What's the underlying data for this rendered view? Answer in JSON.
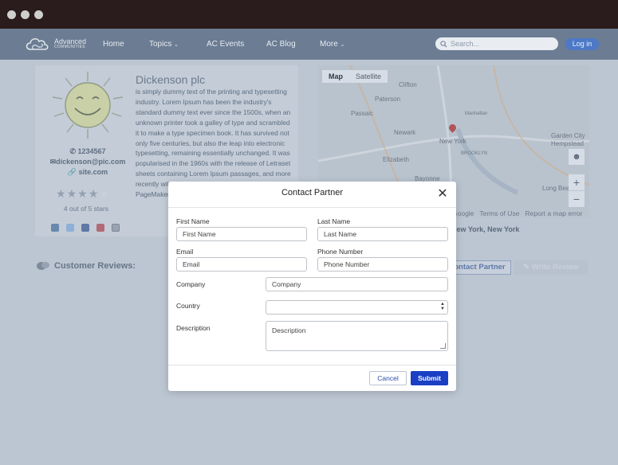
{
  "nav": {
    "logo_line1": "Advanced",
    "logo_line2": "COMMUNITIES",
    "items": [
      {
        "label": "Home"
      },
      {
        "label": "Topics"
      },
      {
        "label": "AC Events"
      },
      {
        "label": "AC Blog"
      },
      {
        "label": "More"
      }
    ],
    "search_placeholder": "Search...",
    "login_label": "Log in"
  },
  "profile": {
    "name": "Dickenson plc",
    "description": "is simply dummy text of the printing and typesetting industry. Lorem Ipsum has been the industry's standard dummy text ever since the 1500s, when an unknown printer took a galley of type and scrambled it to make a type specimen book. It has survived not only five centuries, but also the leap into electronic typesetting, remaining essentially unchanged. It was popularised in the 1960s with the release of Letraset sheets containing Lorem Ipsum passages, and more recently with desktop publishing software like Aldus PageMaker including versions of Lorem Ipsum.",
    "phone": "1234567",
    "email": "dickenson@pic.com",
    "site": "site.com",
    "rating_value": 3.5,
    "rating_max": 5,
    "rating_text": "4 out of 5 stars",
    "social_icons": [
      "linkedin-icon",
      "twitter-icon",
      "facebook-icon",
      "youtube-icon",
      "instagram-icon"
    ]
  },
  "map": {
    "tabs": [
      "Map",
      "Satellite"
    ],
    "labels": [
      "Clifton",
      "Paterson",
      "Passaic",
      "Newark",
      "New York",
      "Elizabeth",
      "Garden City",
      "Hempstead",
      "BROOKLYN",
      "Manhattan",
      "Long Beach",
      "Bayonne"
    ],
    "footer_links": [
      "Google",
      "Terms of Use",
      "Report a map error"
    ],
    "address": "New York, New York"
  },
  "reviews": {
    "heading": "Customer Reviews:",
    "contact_button": "Contact Partner",
    "write_button": "Write Review"
  },
  "modal": {
    "title": "Contact Partner",
    "fields": {
      "first_name": {
        "label": "First Name",
        "placeholder": "First Name"
      },
      "last_name": {
        "label": "Last Name",
        "placeholder": "Last Name"
      },
      "email": {
        "label": "Email",
        "placeholder": "Email"
      },
      "phone": {
        "label": "Phone Number",
        "placeholder": "Phone Number"
      },
      "company": {
        "label": "Company",
        "placeholder": "Company"
      },
      "country": {
        "label": "Country",
        "value": ""
      },
      "description": {
        "label": "Description",
        "placeholder": "Description"
      }
    },
    "cancel_label": "Cancel",
    "submit_label": "Submit"
  },
  "colors": {
    "overlay": "#bcc6d2",
    "nav": "#6b7c93",
    "submit": "#1a3fc4",
    "link_blue": "#2d4ea8"
  }
}
